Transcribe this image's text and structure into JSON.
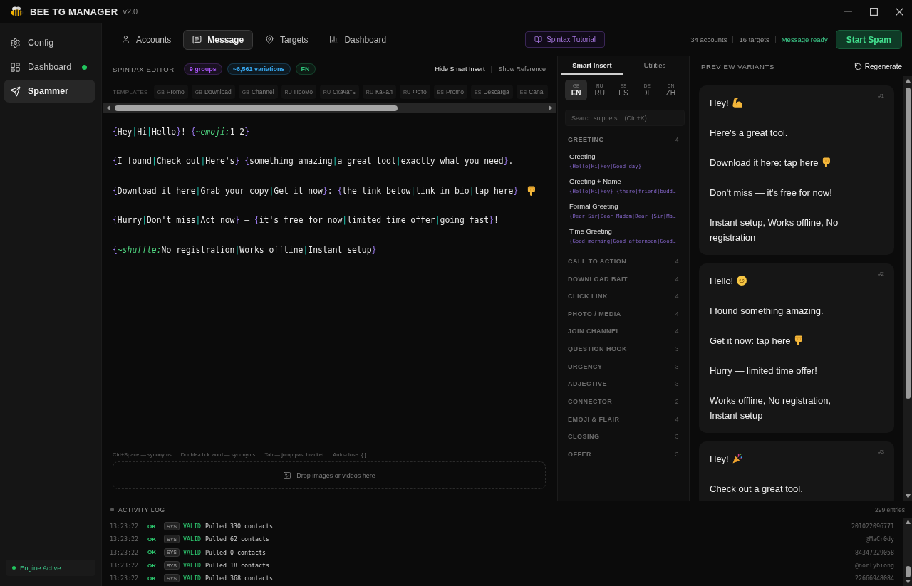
{
  "app": {
    "title": "BEE TG MANAGER",
    "version": "v2.0"
  },
  "sidebar": {
    "items": [
      {
        "label": "Config",
        "selected": false,
        "active": false
      },
      {
        "label": "Dashboard",
        "selected": false,
        "active": true
      },
      {
        "label": "Spammer",
        "selected": true,
        "active": false
      }
    ],
    "engine": {
      "label": "Engine Active",
      "running": true
    }
  },
  "nav_tabs": [
    {
      "label": "Accounts",
      "selected": false
    },
    {
      "label": "Message",
      "selected": true
    },
    {
      "label": "Targets",
      "selected": false
    },
    {
      "label": "Dashboard",
      "selected": false
    }
  ],
  "tutorial_button": "Spintax Tutorial",
  "header_stats": [
    {
      "text": "34 accounts",
      "kind": "count"
    },
    {
      "text": "16 targets",
      "kind": "count"
    },
    {
      "text": "Message ready",
      "kind": "ready"
    }
  ],
  "start_button": "Start Spam",
  "editor": {
    "title": "SPINTAX EDITOR",
    "badges": [
      {
        "text": "9 groups",
        "color": "#a855f7"
      },
      {
        "text": "~6,561 variations",
        "color": "#38a8f0"
      },
      {
        "text": "FN",
        "color": "#2fc27a"
      }
    ],
    "toggles": [
      {
        "label": "Hide Smart Insert",
        "on": true
      },
      {
        "label": "Show Reference",
        "on": false
      }
    ],
    "templates_label": "TEMPLATES",
    "templates": [
      {
        "flag": "GB",
        "label": "Promo"
      },
      {
        "flag": "GB",
        "label": "Download"
      },
      {
        "flag": "GB",
        "label": "Channel"
      },
      {
        "flag": "RU",
        "label": "Промо"
      },
      {
        "flag": "RU",
        "label": "Скачать"
      },
      {
        "flag": "RU",
        "label": "Канал"
      },
      {
        "flag": "RU",
        "label": "Фото"
      },
      {
        "flag": "ES",
        "label": "Promo"
      },
      {
        "flag": "ES",
        "label": "Descarga"
      },
      {
        "flag": "ES",
        "label": "Canal"
      }
    ],
    "lines": [
      [
        {
          "kind": "brace",
          "text": "{"
        },
        {
          "kind": "word",
          "text": "Hey"
        },
        {
          "kind": "pipe",
          "text": "|"
        },
        {
          "kind": "word",
          "text": "Hi"
        },
        {
          "kind": "pipe",
          "text": "|"
        },
        {
          "kind": "word",
          "text": "Hello"
        },
        {
          "kind": "brace",
          "text": "}"
        },
        {
          "kind": "word",
          "text": "! "
        },
        {
          "kind": "brace",
          "text": "{"
        },
        {
          "kind": "func",
          "text": "~emoji:"
        },
        {
          "kind": "word",
          "text": "1-2"
        },
        {
          "kind": "brace",
          "text": "}"
        }
      ],
      [
        {
          "kind": "brace",
          "text": "{"
        },
        {
          "kind": "word",
          "text": "I found"
        },
        {
          "kind": "pipe",
          "text": "|"
        },
        {
          "kind": "word",
          "text": "Check out"
        },
        {
          "kind": "pipe",
          "text": "|"
        },
        {
          "kind": "word",
          "text": "Here's"
        },
        {
          "kind": "brace",
          "text": "} {"
        },
        {
          "kind": "word",
          "text": "something amazing"
        },
        {
          "kind": "pipe",
          "text": "|"
        },
        {
          "kind": "word",
          "text": "a great tool"
        },
        {
          "kind": "pipe",
          "text": "|"
        },
        {
          "kind": "word",
          "text": "exactly what you need"
        },
        {
          "kind": "brace",
          "text": "}"
        },
        {
          "kind": "word",
          "text": "."
        }
      ],
      [
        {
          "kind": "brace",
          "text": "{"
        },
        {
          "kind": "word",
          "text": "Download it here"
        },
        {
          "kind": "pipe",
          "text": "|"
        },
        {
          "kind": "word",
          "text": "Grab your copy"
        },
        {
          "kind": "pipe",
          "text": "|"
        },
        {
          "kind": "word",
          "text": "Get it now"
        },
        {
          "kind": "brace",
          "text": "}"
        },
        {
          "kind": "word",
          "text": ": "
        },
        {
          "kind": "brace",
          "text": "{"
        },
        {
          "kind": "word",
          "text": "the link below"
        },
        {
          "kind": "pipe",
          "text": "|"
        },
        {
          "kind": "word",
          "text": "link in bio"
        },
        {
          "kind": "pipe",
          "text": "|"
        },
        {
          "kind": "word",
          "text": "tap here"
        },
        {
          "kind": "brace",
          "text": "}"
        },
        {
          "kind": "pointdown"
        }
      ],
      [
        {
          "kind": "brace",
          "text": "{"
        },
        {
          "kind": "word",
          "text": "Hurry"
        },
        {
          "kind": "pipe",
          "text": "|"
        },
        {
          "kind": "word",
          "text": "Don't miss"
        },
        {
          "kind": "pipe",
          "text": "|"
        },
        {
          "kind": "word",
          "text": "Act now"
        },
        {
          "kind": "brace",
          "text": "}"
        },
        {
          "kind": "word",
          "text": " — "
        },
        {
          "kind": "brace",
          "text": "{"
        },
        {
          "kind": "word",
          "text": "it's free for now"
        },
        {
          "kind": "pipe",
          "text": "|"
        },
        {
          "kind": "word",
          "text": "limited time offer"
        },
        {
          "kind": "pipe",
          "text": "|"
        },
        {
          "kind": "word",
          "text": "going fast"
        },
        {
          "kind": "brace",
          "text": "}"
        },
        {
          "kind": "word",
          "text": "!"
        }
      ],
      [
        {
          "kind": "brace",
          "text": "{"
        },
        {
          "kind": "func",
          "text": "~shuffle:"
        },
        {
          "kind": "word",
          "text": "No registration"
        },
        {
          "kind": "pipe",
          "text": "|"
        },
        {
          "kind": "word",
          "text": "Works offline"
        },
        {
          "kind": "pipe",
          "text": "|"
        },
        {
          "kind": "word",
          "text": "Instant setup"
        },
        {
          "kind": "brace",
          "text": "}"
        }
      ]
    ],
    "hints": [
      "Ctrl+Space — synonyms",
      "Double-click word — synonyms",
      "Tab — jump past bracket",
      "Auto-close: { ["
    ],
    "drop_zone": "Drop images or videos here"
  },
  "smart_insert": {
    "tabs": [
      {
        "label": "Smart Insert",
        "selected": true
      },
      {
        "label": "Utilities",
        "selected": false
      }
    ],
    "languages": [
      {
        "region": "GB",
        "code": "EN",
        "selected": true
      },
      {
        "region": "RU",
        "code": "RU",
        "selected": false
      },
      {
        "region": "ES",
        "code": "ES",
        "selected": false
      },
      {
        "region": "DE",
        "code": "DE",
        "selected": false
      },
      {
        "region": "CN",
        "code": "ZH",
        "selected": false
      }
    ],
    "search": {
      "placeholder": "Search snippets... (Ctrl+K)"
    },
    "categories": [
      {
        "name": "GREETING",
        "count": "4",
        "expanded": true,
        "snippets": [
          {
            "title": "Greeting",
            "code": "{Hello|Hi|Hey|Good day}"
          },
          {
            "title": "Greeting + Name",
            "code": "{Hello|Hi|Hey} {there|friend|budd…"
          },
          {
            "title": "Formal Greeting",
            "code": "{Dear Sir|Dear Madam|Dear {Sir|Ma…"
          },
          {
            "title": "Time Greeting",
            "code": "{Good morning|Good afternoon|Good…"
          }
        ]
      },
      {
        "name": "CALL TO ACTION",
        "count": "4",
        "expanded": false
      },
      {
        "name": "DOWNLOAD BAIT",
        "count": "4",
        "expanded": false
      },
      {
        "name": "CLICK LINK",
        "count": "4",
        "expanded": false
      },
      {
        "name": "PHOTO / MEDIA",
        "count": "4",
        "expanded": false
      },
      {
        "name": "JOIN CHANNEL",
        "count": "4",
        "expanded": false
      },
      {
        "name": "QUESTION HOOK",
        "count": "3",
        "expanded": false
      },
      {
        "name": "URGENCY",
        "count": "3",
        "expanded": false
      },
      {
        "name": "ADJECTIVE",
        "count": "3",
        "expanded": false
      },
      {
        "name": "CONNECTOR",
        "count": "2",
        "expanded": false
      },
      {
        "name": "EMOJI & FLAIR",
        "count": "4",
        "expanded": false
      },
      {
        "name": "CLOSING",
        "count": "3",
        "expanded": false
      },
      {
        "name": "OFFER",
        "count": "3",
        "expanded": false
      }
    ]
  },
  "preview": {
    "title": "PREVIEW VARIANTS",
    "regenerate": "Regenerate",
    "variants": [
      {
        "number": "#1",
        "paragraphs": [
          {
            "text": "Hey!",
            "kind": "muscle"
          },
          {
            "text": "Here's a great tool.",
            "kind": "plain"
          },
          {
            "text": "Download it here: tap here",
            "kind": "pointdown"
          },
          {
            "text": "Don't miss — it's free for now!",
            "kind": "plain"
          },
          {
            "text": "Instant setup, Works offline, No registration",
            "kind": "plain"
          }
        ]
      },
      {
        "number": "#2",
        "paragraphs": [
          {
            "text": "Hello!",
            "kind": "smile"
          },
          {
            "text": "I found something amazing.",
            "kind": "plain"
          },
          {
            "text": "Get it now: tap here",
            "kind": "pointdown"
          },
          {
            "text": "Hurry — limited time offer!",
            "kind": "plain"
          },
          {
            "text": "Works offline, No registration, Instant setup",
            "kind": "plain"
          }
        ]
      },
      {
        "number": "#3",
        "paragraphs": [
          {
            "text": "Hey!",
            "kind": "party"
          },
          {
            "text": "Check out a great tool.",
            "kind": "plain"
          }
        ]
      }
    ]
  },
  "activity_log": {
    "title": "ACTIVITY LOG",
    "entries": "299 entries",
    "rows": [
      {
        "time": "13:23:22",
        "status": "OK",
        "source": "SYS",
        "result": "VALID",
        "message": "Pulled 330 contacts",
        "reference": "201022096771"
      },
      {
        "time": "13:23:22",
        "status": "OK",
        "source": "SYS",
        "result": "VALID",
        "message": "Pulled 62 contacts",
        "reference": "@MaCr0dy"
      },
      {
        "time": "13:23:22",
        "status": "OK",
        "source": "SYS",
        "result": "VALID",
        "message": "Pulled 0 contacts",
        "reference": "84347229058"
      },
      {
        "time": "13:23:22",
        "status": "OK",
        "source": "SYS",
        "result": "VALID",
        "message": "Pulled 18 contacts",
        "reference": "@norlybiong"
      },
      {
        "time": "13:23:22",
        "status": "OK",
        "source": "SYS",
        "result": "VALID",
        "message": "Pulled 368 contacts",
        "reference": "22666948084"
      }
    ]
  }
}
